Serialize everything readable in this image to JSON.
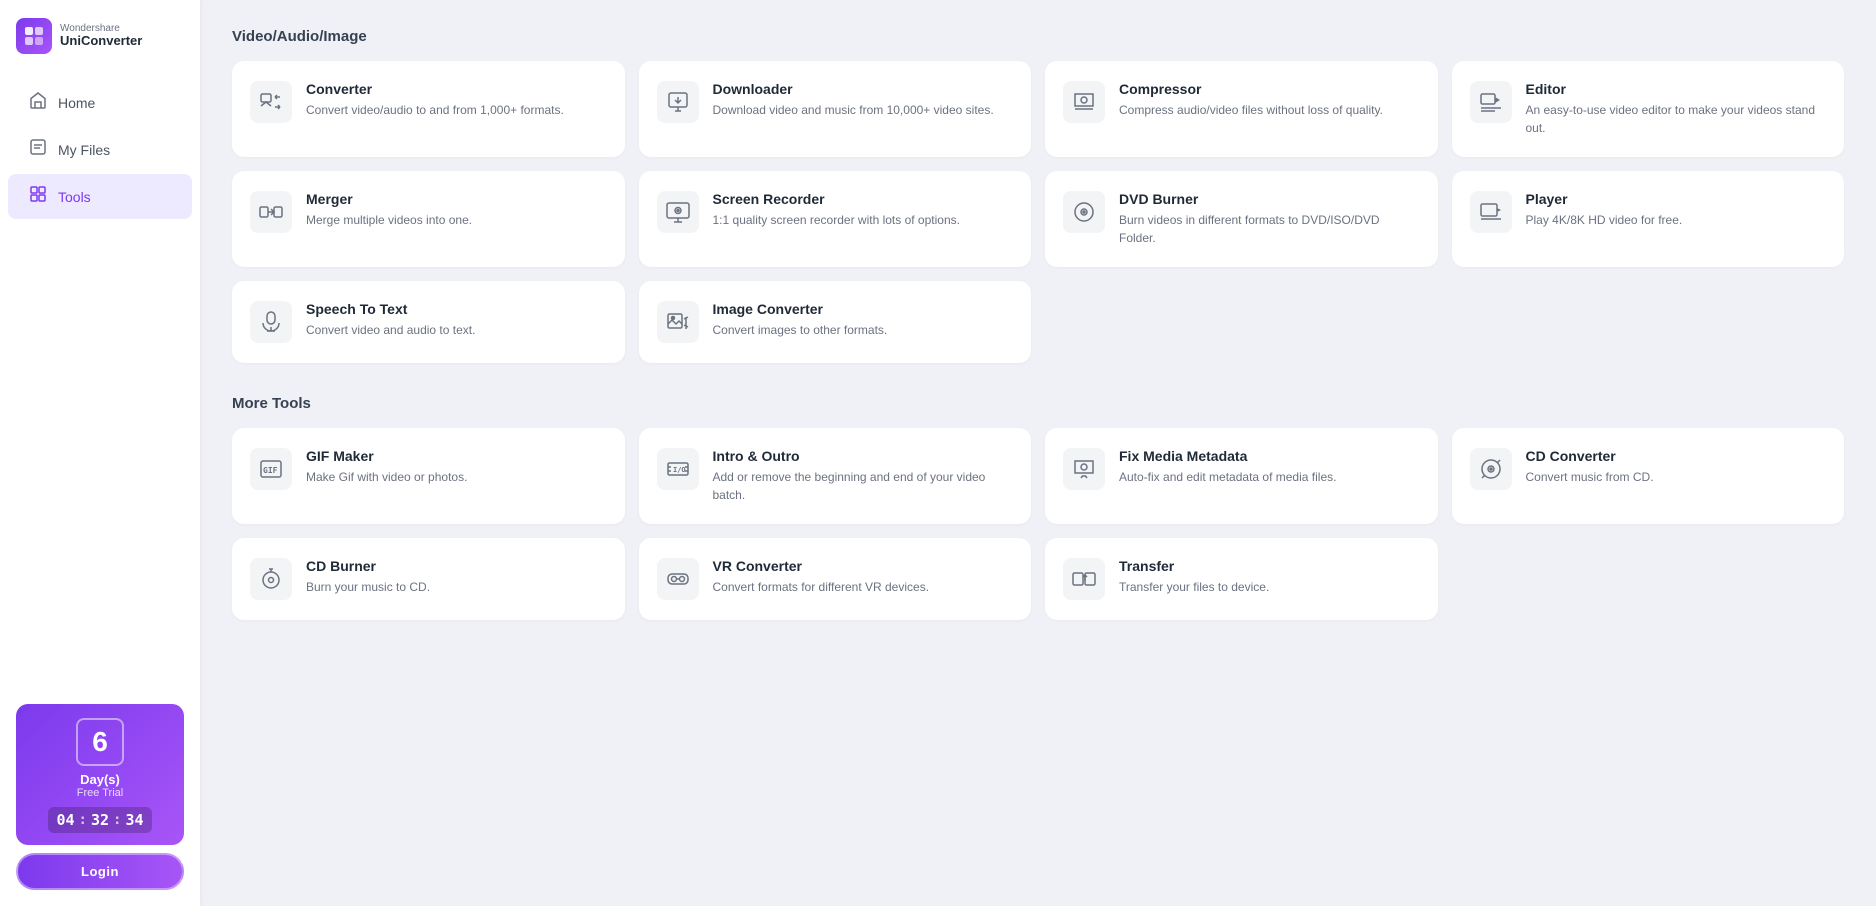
{
  "app": {
    "logo_brand": "Wondershare",
    "logo_product": "UniConverter"
  },
  "sidebar": {
    "nav_items": [
      {
        "id": "home",
        "label": "Home",
        "icon": "home"
      },
      {
        "id": "my-files",
        "label": "My Files",
        "icon": "files"
      },
      {
        "id": "tools",
        "label": "Tools",
        "icon": "tools",
        "active": true
      }
    ]
  },
  "trial": {
    "day_number": "6",
    "day_label": "Day(s)",
    "day_sub": "Free Trial",
    "timer_h": "04",
    "timer_m": "32",
    "timer_s": "34",
    "login_label": "Login"
  },
  "sections": [
    {
      "id": "video-audio-image",
      "title": "Video/Audio/Image",
      "tools": [
        {
          "id": "converter",
          "name": "Converter",
          "desc": "Convert video/audio to and from 1,000+ formats.",
          "icon": "converter"
        },
        {
          "id": "downloader",
          "name": "Downloader",
          "desc": "Download video and music from 10,000+ video sites.",
          "icon": "downloader"
        },
        {
          "id": "compressor",
          "name": "Compressor",
          "desc": "Compress audio/video files without loss of quality.",
          "icon": "compressor"
        },
        {
          "id": "editor",
          "name": "Editor",
          "desc": "An easy-to-use video editor to make your videos stand out.",
          "icon": "editor"
        },
        {
          "id": "merger",
          "name": "Merger",
          "desc": "Merge multiple videos into one.",
          "icon": "merger"
        },
        {
          "id": "screen-recorder",
          "name": "Screen Recorder",
          "desc": "1:1 quality screen recorder with lots of options.",
          "icon": "screen-recorder"
        },
        {
          "id": "dvd-burner",
          "name": "DVD Burner",
          "desc": "Burn videos in different formats to DVD/ISO/DVD Folder.",
          "icon": "dvd-burner"
        },
        {
          "id": "player",
          "name": "Player",
          "desc": "Play 4K/8K HD video for free.",
          "icon": "player"
        },
        {
          "id": "speech-to-text",
          "name": "Speech To Text",
          "desc": "Convert video and audio to text.",
          "icon": "speech-to-text"
        },
        {
          "id": "image-converter",
          "name": "Image Converter",
          "desc": "Convert images to other formats.",
          "icon": "image-converter"
        }
      ]
    },
    {
      "id": "more-tools",
      "title": "More Tools",
      "tools": [
        {
          "id": "gif-maker",
          "name": "GIF Maker",
          "desc": "Make Gif with video or photos.",
          "icon": "gif-maker"
        },
        {
          "id": "intro-outro",
          "name": "Intro & Outro",
          "desc": "Add or remove the beginning and end of your video batch.",
          "icon": "intro-outro"
        },
        {
          "id": "fix-media-metadata",
          "name": "Fix Media Metadata",
          "desc": "Auto-fix and edit metadata of media files.",
          "icon": "fix-media-metadata"
        },
        {
          "id": "cd-converter",
          "name": "CD Converter",
          "desc": "Convert music from CD.",
          "icon": "cd-converter"
        },
        {
          "id": "cd-burner",
          "name": "CD Burner",
          "desc": "Burn your music to CD.",
          "icon": "cd-burner"
        },
        {
          "id": "vr-converter",
          "name": "VR Converter",
          "desc": "Convert formats for different VR devices.",
          "icon": "vr-converter"
        },
        {
          "id": "transfer",
          "name": "Transfer",
          "desc": "Transfer your files to device.",
          "icon": "transfer"
        }
      ]
    }
  ]
}
